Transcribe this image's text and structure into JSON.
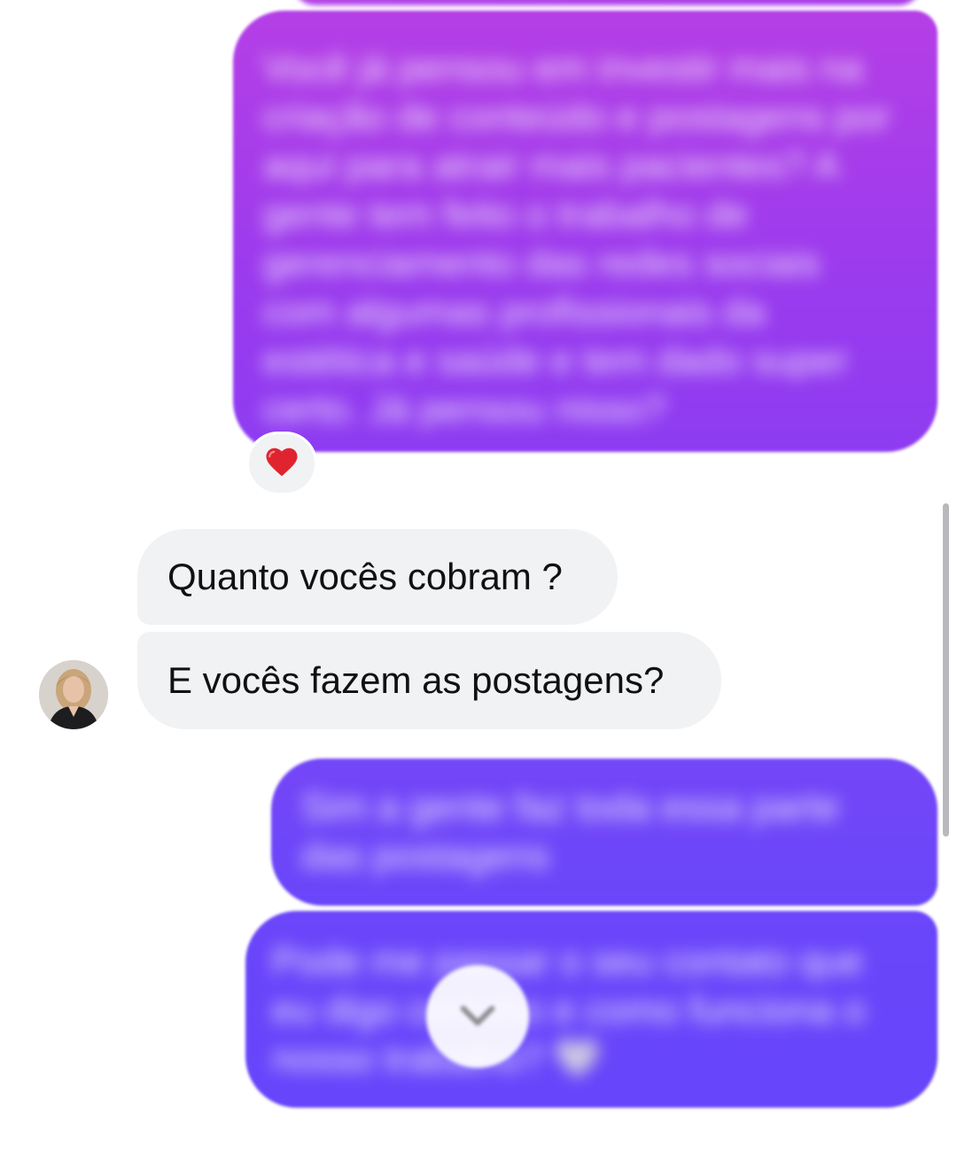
{
  "conversation": {
    "outgoing": [
      {
        "text": "Você já pensou em investir mais na criação de conteúdo e postagens por aqui para atrair mais pacientes? A gente tem feito o trabalho de gerenciamento das redes sociais com algumas profissionais da estética e saúde e tem dado super certo. Já pensou nisso?",
        "reaction": "❤️"
      },
      {
        "text": "Sim a gente faz toda essa parte das postagens"
      },
      {
        "text": "Pode me passar o seu contato que eu digo certinho e como funciona o nosso trabalho? 🤍"
      }
    ],
    "incoming": [
      {
        "text": "Quanto vocês cobram ?"
      },
      {
        "text": "E vocês fazem as postagens?"
      }
    ]
  },
  "icons": {
    "reaction": "red-heart-icon",
    "scroll_down": "chevron-down-icon",
    "avatar": "profile-avatar"
  },
  "colors": {
    "outgoing_top": "#b53fe6",
    "outgoing_bottom": "#6645fb",
    "incoming_bg": "#f1f2f4",
    "heart": "#e0242f"
  }
}
